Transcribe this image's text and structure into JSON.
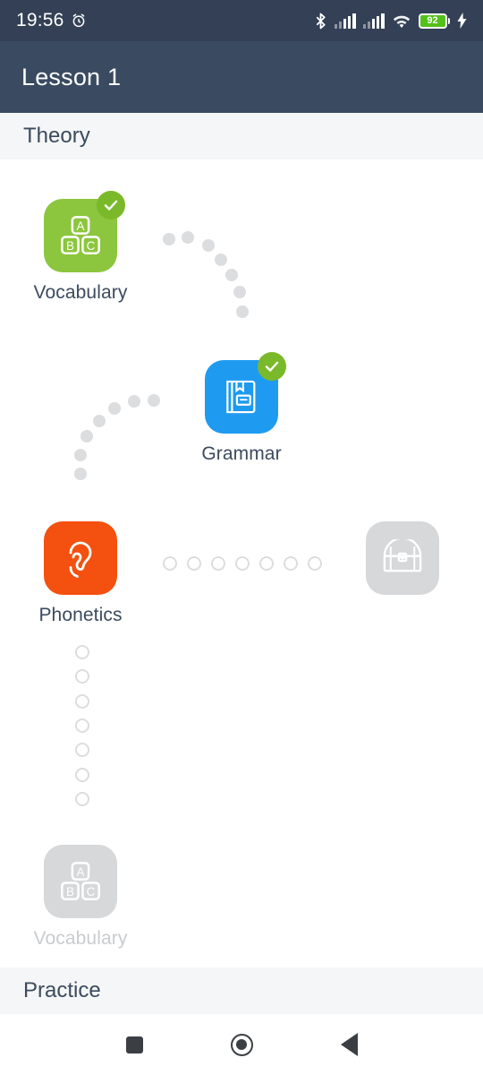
{
  "statusbar": {
    "clock": "19:56",
    "alarm_icon": "alarm-clock-icon",
    "bluetooth_icon": "bluetooth-icon",
    "signal1_icon": "cellular-signal-icon",
    "signal2_icon": "cellular-signal-icon",
    "wifi_icon": "wifi-icon",
    "battery_level": "92",
    "charging_icon": "charging-bolt-icon",
    "background_color": "#334055"
  },
  "appbar": {
    "title": "Lesson 1",
    "background_color": "#3a4a61"
  },
  "sections": {
    "theory": "Theory",
    "practice": "Practice",
    "background_color": "#f5f6f7"
  },
  "nodes": [
    {
      "label": "Vocabulary",
      "icon": "abc-blocks-icon",
      "color": "#8cc63e",
      "completed": true,
      "locked": false,
      "badge_icon": "check-badge-icon",
      "badge_color": "#7ab929"
    },
    {
      "label": "Grammar",
      "icon": "book-icon",
      "color": "#1e9bf0",
      "completed": true,
      "locked": false,
      "badge_icon": "check-badge-icon",
      "badge_color": "#7ab929"
    },
    {
      "label": "Phonetics",
      "icon": "ear-icon",
      "color": "#f4500f",
      "completed": false,
      "locked": false,
      "badge_icon": "",
      "badge_color": ""
    },
    {
      "label": "",
      "icon": "treasure-chest-icon",
      "color": "#d6d8da",
      "completed": false,
      "locked": true,
      "badge_icon": "",
      "badge_color": ""
    },
    {
      "label": "Vocabulary",
      "icon": "abc-blocks-icon",
      "color": "#d6d8da",
      "completed": false,
      "locked": true,
      "badge_icon": "",
      "badge_color": ""
    }
  ],
  "paths": {
    "dot_color": "#dcdddf",
    "filled_count_arc1": 7,
    "filled_count_arc2": 7,
    "hollow_count_row": 7,
    "hollow_count_column": 7
  },
  "navbar": {
    "recents": "recents-square-icon",
    "home": "home-circle-icon",
    "back": "back-triangle-icon",
    "color": "#3b3f44"
  }
}
